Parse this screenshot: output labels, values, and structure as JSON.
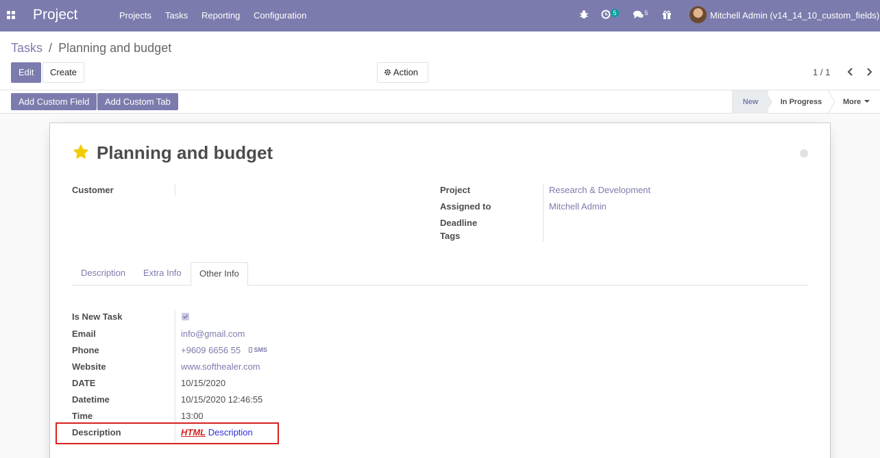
{
  "navbar": {
    "app_name": "Project",
    "menu": [
      "Projects",
      "Tasks",
      "Reporting",
      "Configuration"
    ],
    "activity_count": "5",
    "message_count": "5",
    "user": "Mitchell Admin (v14_14_10_custom_fields)"
  },
  "breadcrumb": {
    "parent": "Tasks",
    "separator": "/",
    "current": "Planning and budget"
  },
  "buttons": {
    "edit": "Edit",
    "create": "Create",
    "action": "Action",
    "add_custom_field": "Add Custom Field",
    "add_custom_tab": "Add Custom Tab"
  },
  "pager": {
    "value": "1 / 1"
  },
  "stages": {
    "new": "New",
    "in_progress": "In Progress",
    "more": "More"
  },
  "task": {
    "title": "Planning and budget",
    "labels": {
      "customer": "Customer",
      "project": "Project",
      "assigned_to": "Assigned to",
      "deadline": "Deadline",
      "tags": "Tags"
    },
    "project": "Research & Development",
    "assigned_to": "Mitchell Admin"
  },
  "tabs": [
    "Description",
    "Extra Info",
    "Other Info"
  ],
  "other_info": {
    "labels": {
      "is_new_task": "Is New Task",
      "email": "Email",
      "phone": "Phone",
      "website": "Website",
      "date": "DATE",
      "datetime": "Datetime",
      "time": "Time",
      "description": "Description"
    },
    "email": "info@gmail.com",
    "phone": "+9609 6656 55",
    "sms": "SMS",
    "website": "www.softhealer.com",
    "date": "10/15/2020",
    "datetime": "10/15/2020 12:46:55",
    "time": "13:00",
    "description_html_tag": "HTML",
    "description_text": "Description"
  },
  "colors": {
    "brand": "#7c7bad",
    "highlight": "#d61f1f",
    "activity_badge": "#00a09d"
  }
}
